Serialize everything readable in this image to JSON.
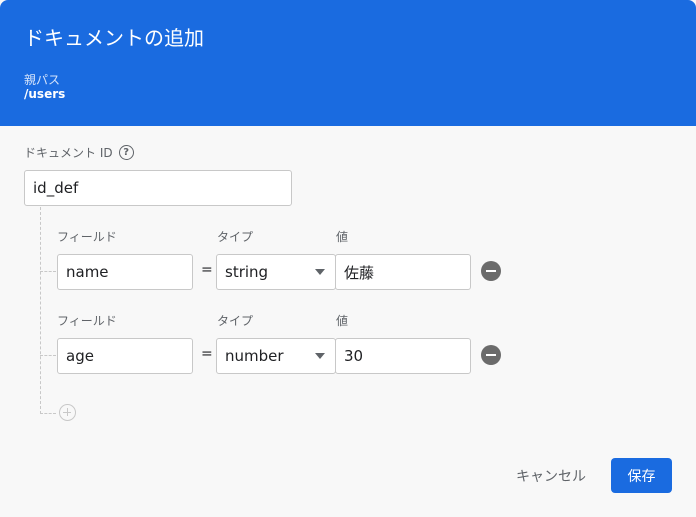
{
  "header": {
    "title": "ドキュメントの追加",
    "parent_path_label": "親パス",
    "parent_path_value": "/users"
  },
  "document_id": {
    "label": "ドキュメント ID",
    "help_icon": "help-icon",
    "value": "id_def"
  },
  "fields": [
    {
      "field_label": "フィールド",
      "type_label": "タイプ",
      "value_label": "値",
      "name": "name",
      "equals": "=",
      "type": "string",
      "value": "佐藤"
    },
    {
      "field_label": "フィールド",
      "type_label": "タイプ",
      "value_label": "値",
      "name": "age",
      "equals": "=",
      "type": "number",
      "value": "30"
    }
  ],
  "actions": {
    "cancel": "キャンセル",
    "save": "保存"
  },
  "colors": {
    "header_bg": "#1a6be0",
    "primary_button": "#1a6be0"
  }
}
